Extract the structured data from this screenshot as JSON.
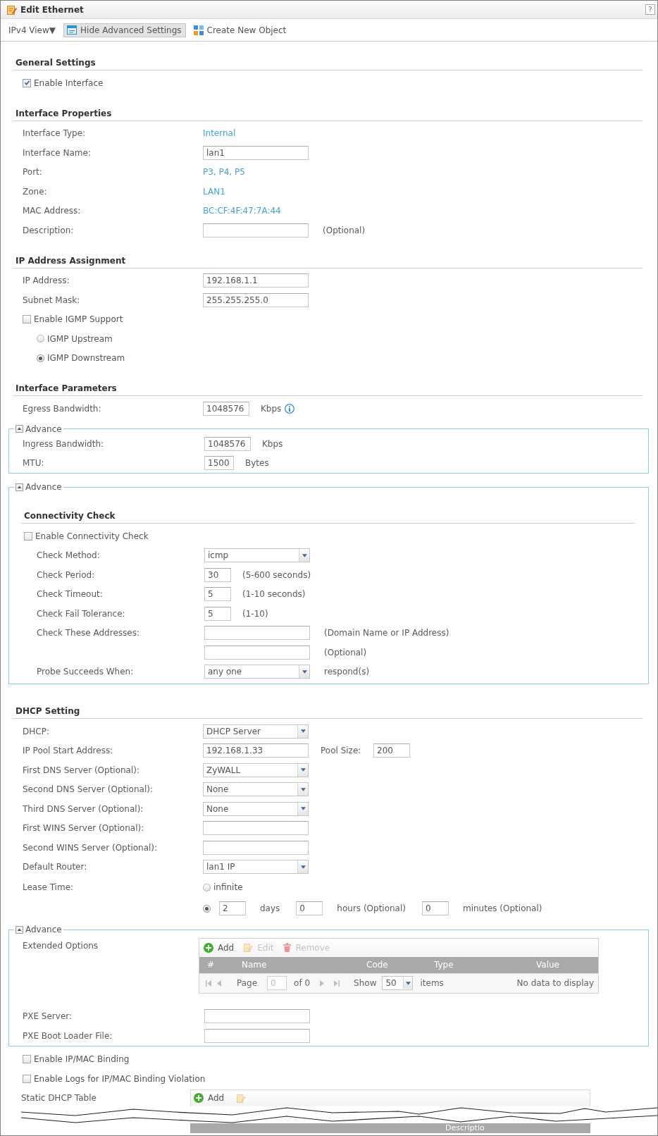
{
  "window": {
    "title": "Edit Ethernet",
    "help": "?"
  },
  "toolbar": [
    {
      "kind": "view_menu",
      "label": "IPv4 View▼",
      "selected": false
    },
    {
      "kind": "toggle_advanced",
      "label": "Hide Advanced Settings",
      "selected": true
    },
    {
      "kind": "create_object",
      "label": "Create New Object",
      "selected": false
    }
  ],
  "blocks": [
    {
      "kind": "section",
      "heading": "General Settings",
      "rows": [
        {
          "kind": "checkbox",
          "label": "Enable Interface",
          "checked": true
        }
      ]
    },
    {
      "kind": "section",
      "heading": "Interface Properties",
      "rows": [
        {
          "kind": "value",
          "label": "Interface Type:",
          "value": "Internal"
        },
        {
          "kind": "input",
          "label": "Interface Name:",
          "value": "lan1"
        },
        {
          "kind": "value",
          "label": "Port:",
          "value": "P3, P4, P5"
        },
        {
          "kind": "value",
          "label": "Zone:",
          "value": "LAN1"
        },
        {
          "kind": "value",
          "label": "MAC Address:",
          "value": "BC:CF:4F:47:7A:44"
        },
        {
          "kind": "input",
          "label": "Description:",
          "suffix": "(Optional)"
        }
      ]
    },
    {
      "kind": "section",
      "heading": "IP Address Assignment",
      "rows": [
        {
          "kind": "input",
          "label": "IP Address:",
          "value": "192.168.1.1"
        },
        {
          "kind": "input",
          "label": "Subnet Mask:",
          "value": "255.255.255.0"
        },
        {
          "kind": "checkbox",
          "label": "Enable IGMP Support",
          "checked": false
        },
        {
          "kind": "radio",
          "label": "IGMP Upstream",
          "selected": false
        },
        {
          "kind": "radio",
          "label": "IGMP Downstream",
          "selected": true
        }
      ]
    },
    {
      "kind": "section",
      "heading": "Interface Parameters",
      "rows": [
        {
          "kind": "number",
          "label": "Egress Bandwidth:",
          "value": "1048576",
          "suffix": "Kbps",
          "info": true
        }
      ]
    },
    {
      "kind": "advance",
      "legend": "Advance",
      "expanded": true,
      "rows": [
        {
          "kind": "number",
          "label": "Ingress Bandwidth:",
          "value": "1048576",
          "suffix": "Kbps"
        },
        {
          "kind": "number",
          "label": "MTU:",
          "value": "1500",
          "suffix": "Bytes"
        }
      ]
    },
    {
      "kind": "advance",
      "legend": "Advance",
      "expanded": true,
      "heading": "Connectivity Check",
      "rows": [
        {
          "kind": "checkbox",
          "label": "Enable Connectivity Check",
          "checked": false
        },
        {
          "kind": "select",
          "label": "Check Method:",
          "value": "icmp"
        },
        {
          "kind": "number",
          "label": "Check Period:",
          "value": "30",
          "suffix": "(5-600 seconds)"
        },
        {
          "kind": "number",
          "label": "Check Timeout:",
          "value": "5",
          "suffix": "(1-10 seconds)"
        },
        {
          "kind": "number",
          "label": "Check Fail Tolerance:",
          "value": "5",
          "suffix": "(1-10)"
        },
        {
          "kind": "input",
          "label": "Check These Addresses:",
          "suffix": "(Domain Name or IP Address)"
        },
        {
          "kind": "input",
          "suffix": "(Optional)"
        },
        {
          "kind": "select",
          "label": "Probe Succeeds When:",
          "value": "any one",
          "suffix": "respond(s)"
        }
      ]
    },
    {
      "kind": "section",
      "heading": "DHCP Setting",
      "rows": [
        {
          "kind": "select",
          "label": "DHCP:",
          "value": "DHCP Server"
        },
        {
          "kind": "input",
          "label": "IP Pool Start Address:",
          "value": "192.168.1.33",
          "extra_label": "Pool Size:",
          "extra_value": "200"
        },
        {
          "kind": "select",
          "label": "First DNS Server (Optional):",
          "value": "ZyWALL"
        },
        {
          "kind": "select",
          "label": "Second DNS Server (Optional):",
          "value": "None"
        },
        {
          "kind": "select",
          "label": "Third DNS Server (Optional):",
          "value": "None"
        },
        {
          "kind": "input",
          "label": "First WINS Server (Optional):"
        },
        {
          "kind": "input",
          "label": "Second WINS Server (Optional):"
        },
        {
          "kind": "select",
          "label": "Default Router:",
          "value": "lan1 IP"
        },
        {
          "kind": "radio_choice",
          "label": "Lease Time:",
          "option": "infinite",
          "selected": false
        },
        {
          "kind": "lease",
          "selected": true,
          "fields": [
            {
              "value": "2",
              "unit": "days"
            },
            {
              "value": "0",
              "unit": "hours (Optional)"
            },
            {
              "value": "0",
              "unit": "minutes (Optional)"
            }
          ]
        }
      ]
    },
    {
      "kind": "advance",
      "legend": "Advance",
      "expanded": true,
      "rows": [
        {
          "kind": "table",
          "label": "Extended Options",
          "actions": [
            {
              "kind": "add",
              "label": "Add",
              "disabled": false
            },
            {
              "kind": "edit",
              "label": "Edit",
              "disabled": true
            },
            {
              "kind": "remove",
              "label": "Remove",
              "disabled": true
            }
          ],
          "columns": [
            "#",
            "Name",
            "Code",
            "Type",
            "Value"
          ],
          "pager": {
            "page_label": "Page",
            "page": "0",
            "of_label": "of 0",
            "show_label": "Show",
            "per_page": "50",
            "items_label": "items",
            "empty_text": "No data to display",
            "disabled": true
          }
        },
        {
          "kind": "input",
          "label": "PXE Server:"
        },
        {
          "kind": "input",
          "label": "PXE Boot Loader File:"
        }
      ]
    },
    {
      "kind": "plain",
      "rows": [
        {
          "kind": "checkbox",
          "label": "Enable IP/MAC Binding",
          "checked": false
        },
        {
          "kind": "checkbox",
          "label": "Enable Logs for IP/MAC Binding Violation",
          "checked": false
        },
        {
          "kind": "table_cut",
          "label": "Static DHCP Table",
          "actions": [
            {
              "kind": "add",
              "label": "Add",
              "disabled": false
            },
            {
              "kind": "edit",
              "disabled": true
            }
          ],
          "columns": [
            "Descriptio"
          ]
        }
      ]
    }
  ]
}
